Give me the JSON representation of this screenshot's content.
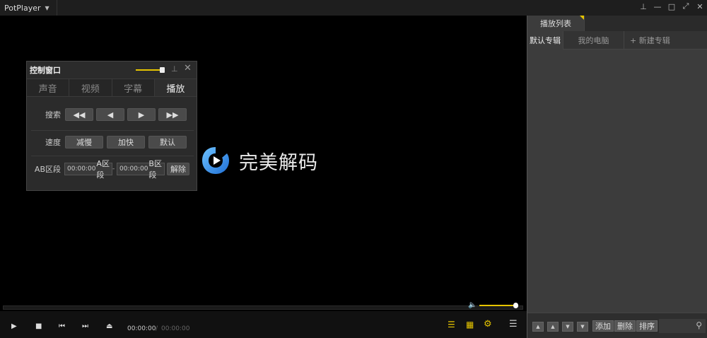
{
  "app": {
    "title": "PotPlayer",
    "menu_chevron": "chevron-down-icon"
  },
  "window_controls": [
    "pin-icon",
    "minimize-icon",
    "maximize-icon",
    "fullscreen-icon",
    "close-icon"
  ],
  "video": {
    "logo_text": "完美解码"
  },
  "control_window": {
    "title": "控制窗口",
    "tabs": [
      {
        "label": "声音",
        "active": false
      },
      {
        "label": "视频",
        "active": false
      },
      {
        "label": "字幕",
        "active": false
      },
      {
        "label": "播放",
        "active": true
      }
    ],
    "search_label": "搜索",
    "search_buttons": [
      "rewind-fast-icon",
      "step-back-icon",
      "step-forward-icon",
      "forward-fast-icon"
    ],
    "speed_label": "速度",
    "speed_buttons": [
      "减慢",
      "加快",
      "默认"
    ],
    "ab_label": "AB区段",
    "ab_a_time": "00:00:00",
    "ab_a_label": "A区段",
    "ab_dash": "-",
    "ab_b_time": "00:00:00",
    "ab_b_label": "B区段",
    "ab_clear": "解除"
  },
  "player": {
    "time_current": "00:00:00",
    "time_separator": "/",
    "time_total": "00:00:00",
    "volume_level": 1.0,
    "accent_color": "#e6c500"
  },
  "playlist": {
    "tab_label": "播放列表",
    "subtabs": [
      "默认专辑",
      "我的电脑",
      "+ 新建专辑"
    ],
    "footer_buttons": [
      "添加",
      "删除",
      "排序"
    ]
  }
}
